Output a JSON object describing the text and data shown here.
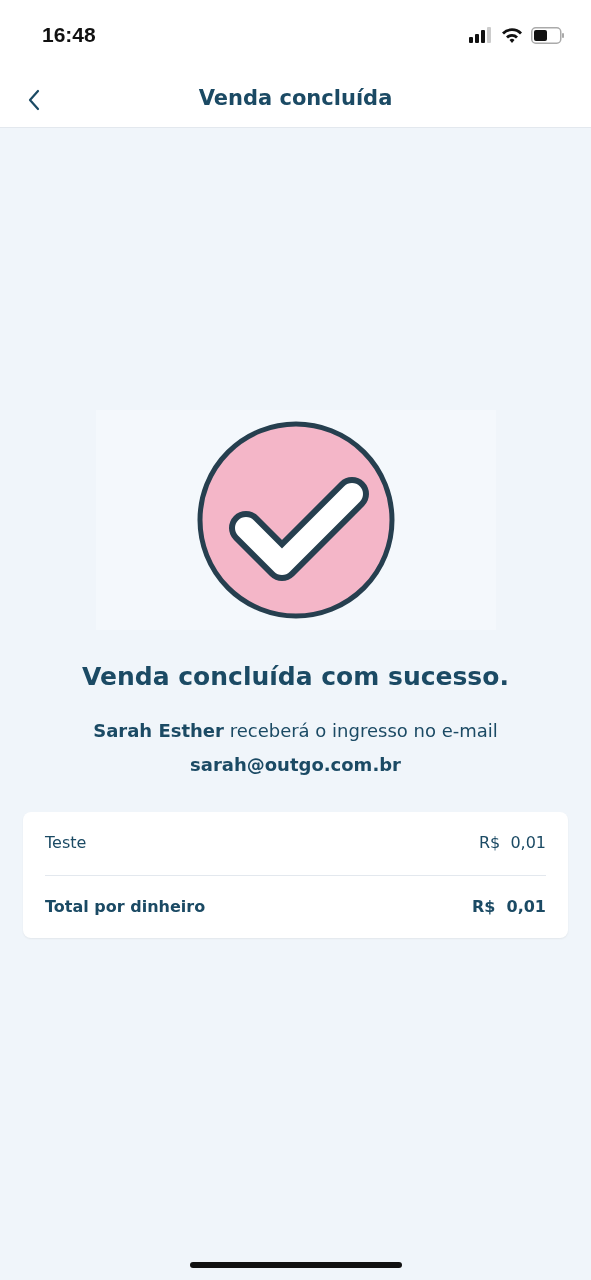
{
  "status_bar": {
    "time": "16:48"
  },
  "header": {
    "title": "Venda concluída"
  },
  "result": {
    "title": "Venda concluída com sucesso.",
    "message": "**Sarah Esther** receberá o ingresso no e-mail **sarah@outgo.com.br**"
  },
  "summary": [
    {
      "kind": "item",
      "label": "Teste",
      "amount": "R$  0,01"
    },
    {
      "kind": "total",
      "label": "Total por dinheiro",
      "amount": "R$  0,01"
    }
  ]
}
